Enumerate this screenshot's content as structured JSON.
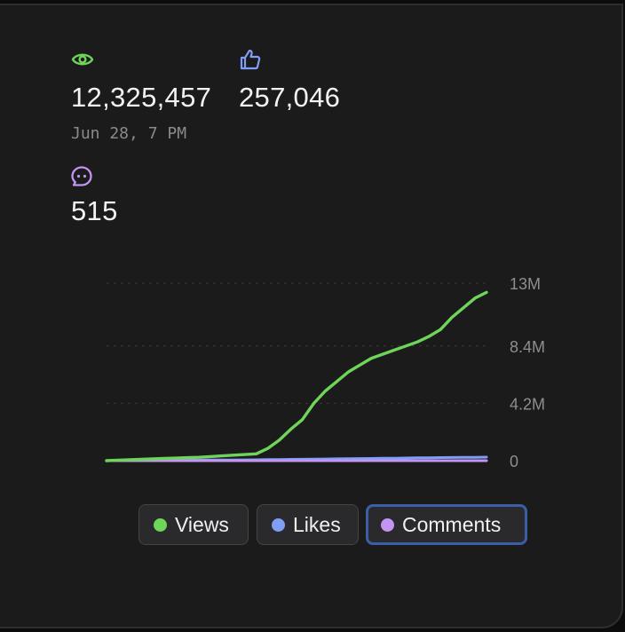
{
  "stats": {
    "views": {
      "value": "12,325,457",
      "icon": "eye-icon",
      "color": "#6fd45a"
    },
    "likes": {
      "value": "257,046",
      "icon": "thumbs-up-icon",
      "color": "#7f9ef5"
    },
    "comments": {
      "value": "515",
      "icon": "chat-bubble-icon",
      "color": "#c395f2"
    },
    "timestamp": "Jun 28, 7 PM"
  },
  "legend": {
    "views": {
      "label": "Views",
      "color": "#6fd45a"
    },
    "likes": {
      "label": "Likes",
      "color": "#7f9ef5"
    },
    "comments": {
      "label": "Comments",
      "color": "#c395f2",
      "selected": true
    }
  },
  "chart_data": {
    "type": "line",
    "ylim": [
      0,
      13000000
    ],
    "y_ticks": [
      0,
      4200000,
      8400000,
      13000000
    ],
    "y_tick_labels": [
      "0",
      "4.2M",
      "8.4M",
      "13M"
    ],
    "grid": true,
    "y_axis_position": "right",
    "series": [
      {
        "name": "Views",
        "color": "#6fd45a",
        "values": [
          0,
          40000,
          70000,
          100000,
          130000,
          160000,
          190000,
          220000,
          250000,
          300000,
          350000,
          400000,
          450000,
          500000,
          900000,
          1500000,
          2300000,
          3000000,
          4200000,
          5100000,
          5800000,
          6500000,
          7000000,
          7500000,
          7800000,
          8100000,
          8400000,
          8700000,
          9100000,
          9600000,
          10500000,
          11200000,
          11900000,
          12325457
        ]
      },
      {
        "name": "Likes",
        "color": "#7f9ef5",
        "values": [
          0,
          5000,
          10000,
          15000,
          20000,
          25000,
          30000,
          35000,
          40000,
          45000,
          50000,
          55000,
          60000,
          65000,
          75000,
          85000,
          95000,
          105000,
          115000,
          125000,
          135000,
          145000,
          155000,
          165000,
          175000,
          185000,
          195000,
          205000,
          215000,
          225000,
          235000,
          243000,
          250000,
          257046
        ]
      },
      {
        "name": "Comments",
        "color": "#c395f2",
        "values": [
          0,
          10,
          20,
          30,
          40,
          50,
          60,
          70,
          80,
          90,
          100,
          110,
          120,
          130,
          145,
          160,
          175,
          190,
          205,
          220,
          235,
          250,
          265,
          280,
          300,
          320,
          340,
          360,
          380,
          400,
          430,
          460,
          490,
          515
        ]
      }
    ]
  }
}
